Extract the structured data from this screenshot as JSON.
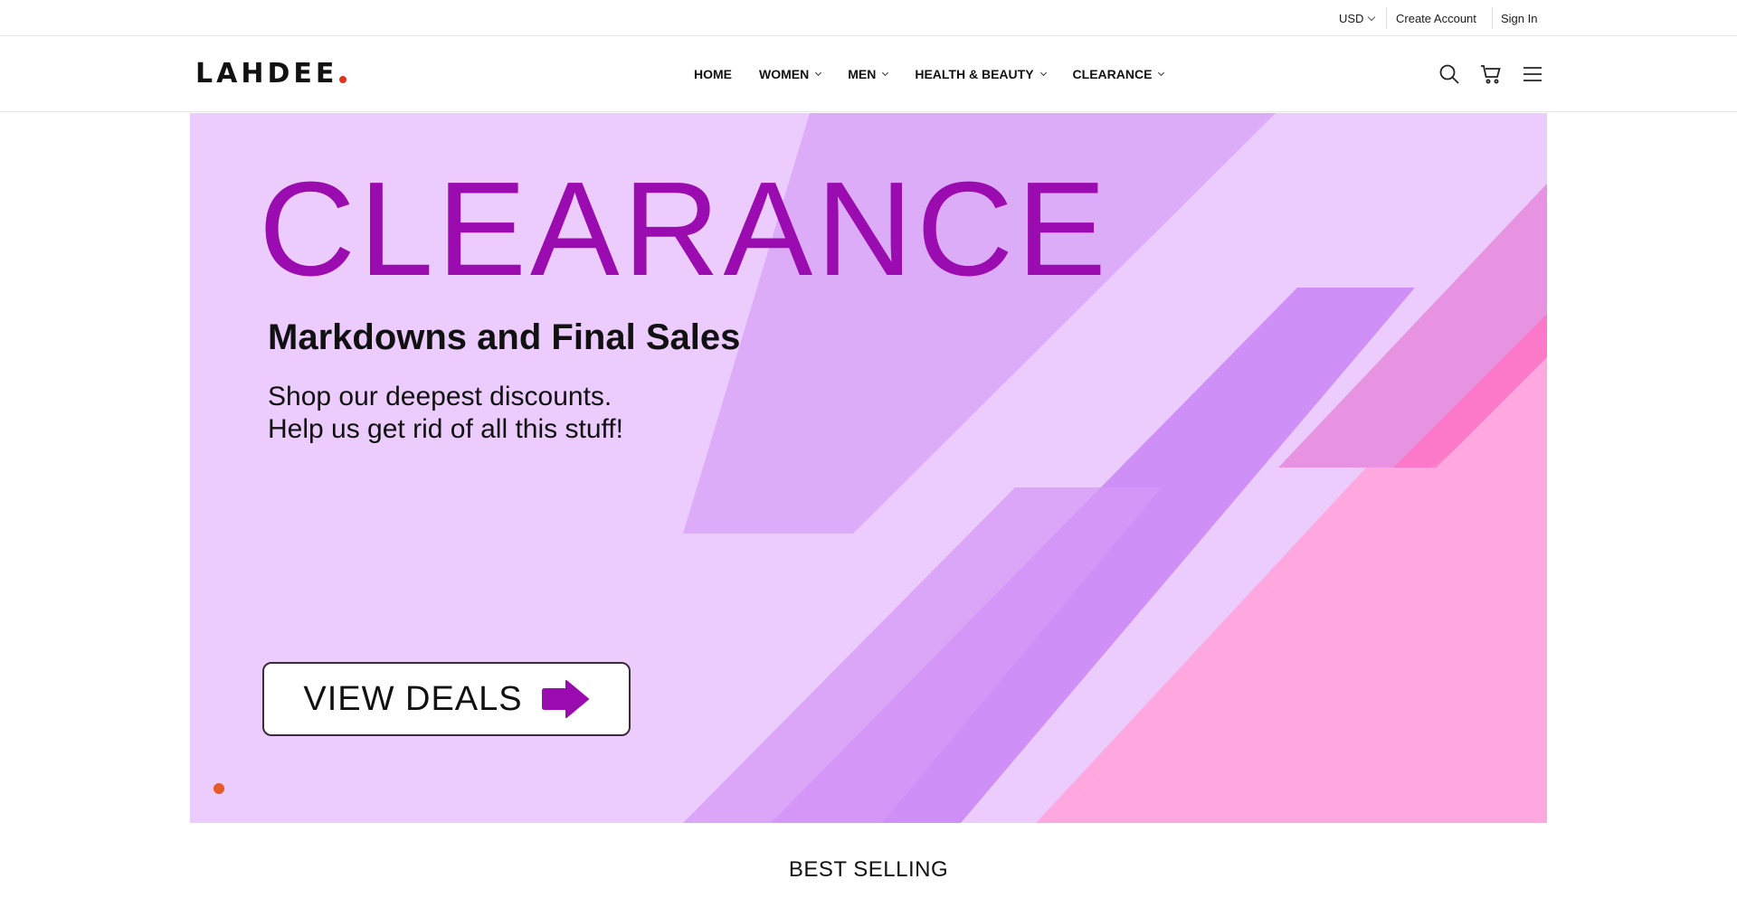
{
  "topbar": {
    "currency": "USD",
    "create_account": "Create Account",
    "sign_in": "Sign In"
  },
  "header": {
    "logo_text": "LAHDEE",
    "nav": [
      {
        "label": "HOME",
        "has_dropdown": false
      },
      {
        "label": "WOMEN",
        "has_dropdown": true
      },
      {
        "label": "MEN",
        "has_dropdown": true
      },
      {
        "label": "HEALTH & BEAUTY",
        "has_dropdown": true
      },
      {
        "label": "CLEARANCE",
        "has_dropdown": true
      }
    ],
    "icons": [
      "search-icon",
      "cart-icon",
      "menu-icon"
    ]
  },
  "hero": {
    "title": "CLEARANCE",
    "subtitle": "Markdowns and Final Sales",
    "description": "Shop our deepest discounts.\nHelp us get rid of all this stuff!",
    "cta_label": "VIEW DEALS",
    "colors": {
      "background": "#ecccfc",
      "title": "#9a0bb0",
      "accent_pink": "#ffa8e0",
      "accent_purple": "#c47cf6",
      "arrow": "#9a0bb0",
      "carousel_dot": "#e65a25"
    },
    "carousel_active_index": 0
  },
  "sections": {
    "best_selling_title": "BEST SELLING"
  }
}
